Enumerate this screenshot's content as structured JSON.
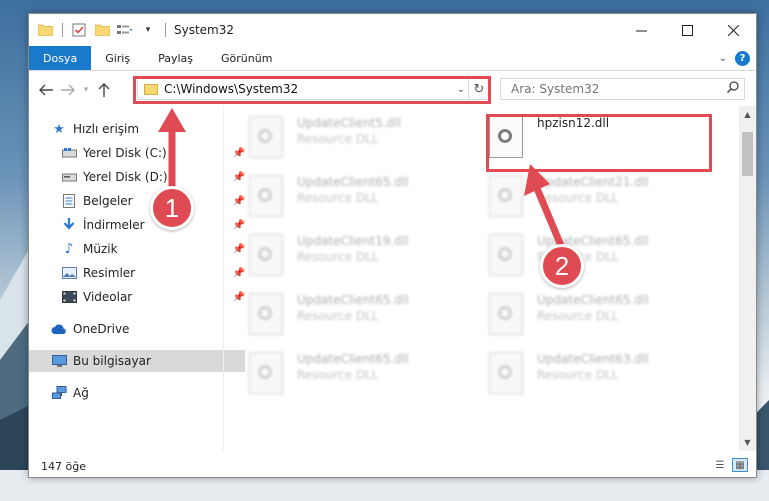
{
  "window": {
    "title": "System32"
  },
  "ribbon": {
    "tabs": [
      "Dosya",
      "Giriş",
      "Paylaş",
      "Görünüm"
    ]
  },
  "navbar": {
    "address_path": "C:\\Windows\\System32",
    "search_placeholder": "Ara: System32"
  },
  "sidebar": {
    "quick_access": "Hızlı erişim",
    "items": [
      {
        "label": "Yerel Disk (C:)",
        "icon": "drive-icon",
        "pinned": true
      },
      {
        "label": "Yerel Disk (D:)",
        "icon": "drive-icon",
        "pinned": true
      },
      {
        "label": "Belgeler",
        "icon": "documents-icon",
        "pinned": true
      },
      {
        "label": "İndirmeler",
        "icon": "downloads-icon",
        "pinned": true
      },
      {
        "label": "Müzik",
        "icon": "music-icon",
        "pinned": true
      },
      {
        "label": "Resimler",
        "icon": "pictures-icon",
        "pinned": true
      },
      {
        "label": "Videolar",
        "icon": "videos-icon",
        "pinned": true
      }
    ],
    "onedrive": "OneDrive",
    "this_pc": "Bu bilgisayar",
    "network": "Ağ"
  },
  "files": [
    {
      "name": "UpdateClient5.dll",
      "desc": "Resource DLL"
    },
    {
      "name": "hpzisn12.dll",
      "desc": ""
    },
    {
      "name": "UpdateClient65.dll",
      "desc": "Resource DLL"
    },
    {
      "name": "UpdateClient21.dll",
      "desc": "Resource DLL"
    },
    {
      "name": "UpdateClient19.dll",
      "desc": "Resource DLL"
    },
    {
      "name": "UpdateClient65.dll",
      "desc": "Resource DLL"
    },
    {
      "name": "UpdateClient65.dll",
      "desc": "Resource DLL"
    },
    {
      "name": "UpdateClient65.dll",
      "desc": "Resource DLL"
    },
    {
      "name": "UpdateClient65.dll",
      "desc": "Resource DLL"
    },
    {
      "name": "UpdateClient63.dll",
      "desc": "Resource DLL"
    }
  ],
  "status": {
    "item_count": "147 öğe"
  },
  "annotations": {
    "badge1": "1",
    "badge2": "2",
    "color": "#e04a52"
  },
  "colors": {
    "accent": "#1979ca",
    "folder": "#f8d775",
    "selected_bg": "#d9d9d9"
  }
}
